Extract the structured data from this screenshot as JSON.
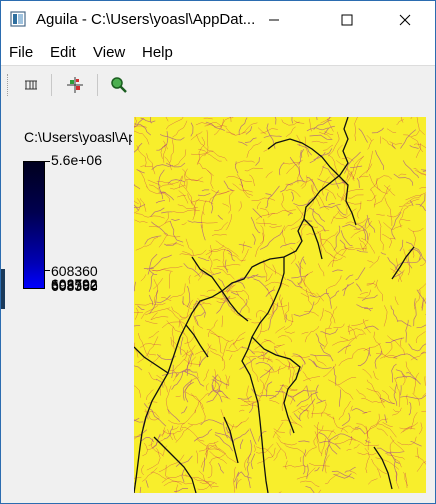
{
  "window": {
    "title": "Aguila - C:\\Users\\yoasl\\AppDat...",
    "app_icon": "aguila-window-icon",
    "controls": [
      "minimize-icon",
      "maximize-icon",
      "close-icon"
    ]
  },
  "menu": {
    "items": [
      {
        "label": "File"
      },
      {
        "label": "Edit"
      },
      {
        "label": "View"
      },
      {
        "label": "Help"
      }
    ]
  },
  "toolbar": {
    "buttons": [
      {
        "icon": "columns-view-icon"
      },
      {
        "icon": "crosshair-cursor-icon"
      },
      {
        "icon": "zoom-icon"
      }
    ]
  },
  "legend": {
    "layer_name": "C:\\Users\\yoasl\\AppData",
    "max_label": "5.6e+06",
    "min_label": "608360",
    "overlapping_labels": [
      "603792",
      "598592",
      "608360"
    ],
    "colors": {
      "top": "#00001e",
      "bottom": "#0000ff"
    }
  },
  "map": {
    "colors": {
      "background": "#f8ee2c",
      "streams": "#c2185b",
      "divides": "#111111"
    }
  }
}
